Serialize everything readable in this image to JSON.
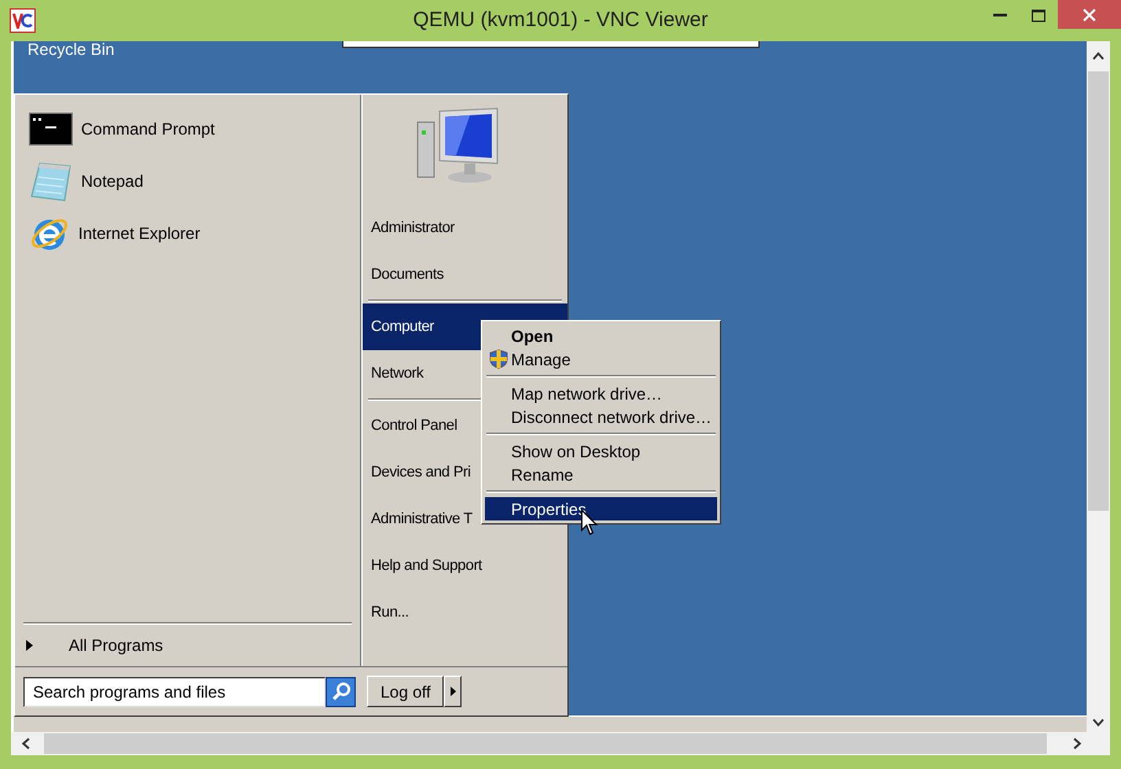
{
  "window": {
    "title": "QEMU (kvm1001) - VNC Viewer"
  },
  "desktop_icons": [
    {
      "label": "Recycle Bin"
    }
  ],
  "start_menu": {
    "pinned": [
      {
        "label": "Command Prompt",
        "kind": "cmd"
      },
      {
        "label": "Notepad",
        "kind": "notepad"
      },
      {
        "label": "Internet Explorer",
        "kind": "ie"
      }
    ],
    "all_programs": "All Programs",
    "search": {
      "placeholder": "Search programs and files"
    },
    "place_groups": [
      [
        {
          "label": "Administrator",
          "selected": false
        },
        {
          "label": "Documents",
          "selected": false
        }
      ],
      [
        {
          "label": "Computer",
          "selected": true
        },
        {
          "label": "Network",
          "selected": false
        }
      ],
      [
        {
          "label": "Control Panel",
          "selected": false
        },
        {
          "label": "Devices and Pri",
          "selected": false
        },
        {
          "label": "Administrative T",
          "selected": false
        },
        {
          "label": "Help and Support",
          "selected": false
        },
        {
          "label": "Run...",
          "selected": false
        }
      ]
    ],
    "log_off": "Log off"
  },
  "context_menu": {
    "groups": [
      [
        {
          "label": "Open",
          "kind": "default",
          "selected": false
        },
        {
          "label": "Manage",
          "kind": "shield",
          "selected": false
        }
      ],
      [
        {
          "label": "Map network drive…",
          "kind": "plain",
          "selected": false
        },
        {
          "label": "Disconnect network drive…",
          "kind": "plain",
          "selected": false
        }
      ],
      [
        {
          "label": "Show on Desktop",
          "kind": "plain",
          "selected": false
        },
        {
          "label": "Rename",
          "kind": "plain",
          "selected": false
        }
      ],
      [
        {
          "label": "Properties",
          "kind": "plain",
          "selected": true
        }
      ]
    ]
  }
}
